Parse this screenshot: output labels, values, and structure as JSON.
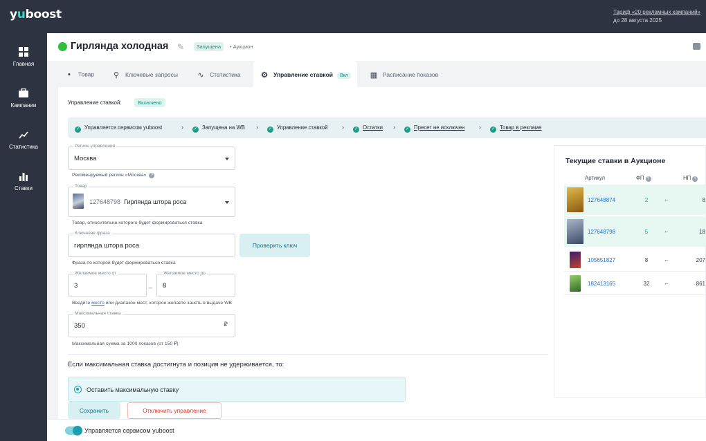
{
  "app": {
    "logo_prefix": "y",
    "logo_accent": "u",
    "logo_suffix": "boost",
    "tariff_link": "Тариф «20 рекламных кампаний»",
    "tariff_until": "до 28 августа 2025"
  },
  "sidebar": {
    "items": [
      {
        "label": "Главная",
        "icon": "grid-icon"
      },
      {
        "label": "Кампании",
        "icon": "briefcase-icon"
      },
      {
        "label": "Статистика",
        "icon": "trend-icon"
      },
      {
        "label": "Ставки",
        "icon": "bars-icon"
      }
    ]
  },
  "header": {
    "title": "Гирлянда холодная",
    "status": "Запущена",
    "separator": "•",
    "type": "Аукцион"
  },
  "tabs": [
    {
      "label": "Товар",
      "icon": "bag-icon"
    },
    {
      "label": "Ключевые запросы",
      "icon": "search-icon"
    },
    {
      "label": "Статистика",
      "icon": "trend-icon"
    },
    {
      "label": "Управление ставкой",
      "icon": "gear-icon",
      "badge": "Вкл",
      "active": true
    },
    {
      "label": "Расписание показов",
      "icon": "calendar-icon"
    }
  ],
  "control": {
    "label": "Управление ставкой:",
    "state": "Включено"
  },
  "steps": [
    {
      "label": "Управляется сервисом yuboost",
      "underline": false
    },
    {
      "label": "Запущена на WB",
      "underline": false
    },
    {
      "label": "Управление ставкой",
      "underline": false
    },
    {
      "label": "Остатки",
      "underline": true
    },
    {
      "label": "Пресет не исключен",
      "underline": true
    },
    {
      "label": "Товар в рекламе",
      "underline": true
    }
  ],
  "form": {
    "region": {
      "label": "Регион управления",
      "value": "Москва",
      "hint": "Рекомендуемый регион «Москва»"
    },
    "product": {
      "label": "Товар",
      "article": "127648798",
      "name": "Гирлянда штора роса",
      "hint": "Товар, относительно которого будет формироваться ставка"
    },
    "keyword": {
      "label": "Ключевая фраза",
      "value": "гирлянда штора роса",
      "button": "Проверить ключ",
      "hint": "Фраза по которой будет формироваться ставка"
    },
    "place_from": {
      "label": "Желаемое место от",
      "value": "3"
    },
    "place_dash": "–",
    "place_to": {
      "label": "Желаемое место до",
      "value": "8"
    },
    "place_hint_pre": "Введите",
    "place_hint_link": "место",
    "place_hint_post": "или диапазон мест, которое желаете занять в выдаче WB",
    "max_bid": {
      "label": "Максимальная ставка",
      "value": "350",
      "currency": "₽",
      "hint": "Максимальная сумма за 1000 показов (от 150 ₽)"
    }
  },
  "condition": {
    "text": "Если максимальная ставка достигнута и позиция не удерживается, то:",
    "option": "Оставить максимальную ставку"
  },
  "buttons": {
    "save": "Сохранить",
    "disable": "Отключить управление"
  },
  "auction": {
    "title": "Текущие ставки в Аукционе",
    "col_article": "Артикул",
    "col_fp": "ФП",
    "col_np": "НП",
    "rows": [
      {
        "article": "127648874",
        "fp": "2",
        "np": "8",
        "highlight": true,
        "thumb_color": "#c49a2e"
      },
      {
        "article": "127648798",
        "fp": "5",
        "np": "18",
        "highlight": true,
        "thumb_color": "#7b8aa8"
      },
      {
        "article": "105651827",
        "fp": "8",
        "np": "207",
        "highlight": false,
        "thumb_color": "#c0452e"
      },
      {
        "article": "182413165",
        "fp": "32",
        "np": "861",
        "highlight": false,
        "thumb_color": "#5a9a3c"
      }
    ]
  },
  "footer": {
    "toggle_label": "Управляется сервисом yuboost",
    "toggle_on": true
  }
}
